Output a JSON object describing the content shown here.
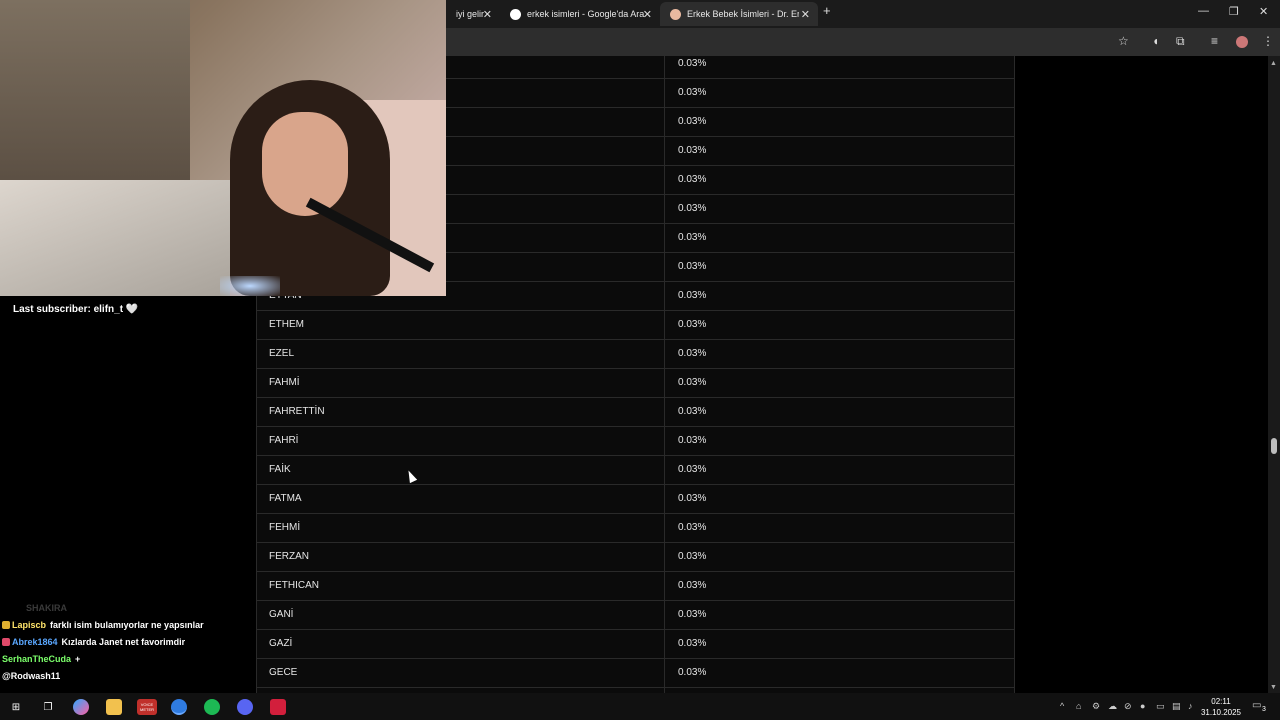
{
  "browser": {
    "tabs": [
      {
        "label": "iyi gelir",
        "active": false
      },
      {
        "label": "erkek isimleri - Google'da Ara",
        "active": false
      },
      {
        "label": "Erkek Bebek İsimleri - Dr. Ertuğ",
        "active": true
      }
    ],
    "new_tab": "+",
    "controls": {
      "minimize": "—",
      "restore": "❐",
      "close": "✕"
    }
  },
  "table": {
    "rows": [
      {
        "name": "",
        "percent": "0.03%"
      },
      {
        "name": "",
        "percent": "0.03%"
      },
      {
        "name": "",
        "percent": "0.03%"
      },
      {
        "name": "",
        "percent": "0.03%"
      },
      {
        "name": "",
        "percent": "0.03%"
      },
      {
        "name": "",
        "percent": "0.03%"
      },
      {
        "name": "",
        "percent": "0.03%"
      },
      {
        "name": "",
        "percent": "0.03%"
      },
      {
        "name": "EYTAN",
        "percent": "0.03%"
      },
      {
        "name": "ETHEM",
        "percent": "0.03%"
      },
      {
        "name": "EZEL",
        "percent": "0.03%"
      },
      {
        "name": "FAHMİ",
        "percent": "0.03%"
      },
      {
        "name": "FAHRETTİN",
        "percent": "0.03%"
      },
      {
        "name": "FAHRİ",
        "percent": "0.03%"
      },
      {
        "name": "FAİK",
        "percent": "0.03%"
      },
      {
        "name": "FATMA",
        "percent": "0.03%"
      },
      {
        "name": "FEHMİ",
        "percent": "0.03%"
      },
      {
        "name": "FERZAN",
        "percent": "0.03%"
      },
      {
        "name": "FETHICAN",
        "percent": "0.03%"
      },
      {
        "name": "GANİ",
        "percent": "0.03%"
      },
      {
        "name": "GAZİ",
        "percent": "0.03%"
      },
      {
        "name": "GECE",
        "percent": "0.03%"
      },
      {
        "name": "",
        "percent": ""
      }
    ]
  },
  "overlay": {
    "last_subscriber": "Last subscriber: elifn_t 🤍",
    "chat": [
      {
        "user": "SHAKIRA",
        "message": "",
        "user_color": "#3a3a3a"
      },
      {
        "user": "Lapiscb",
        "message": "farklı isim bulamıyorlar ne yapsınlar",
        "user_color": "#ffe56b"
      },
      {
        "user": "Abrek1864",
        "message": "Kızlarda Janet net favorimdir",
        "user_color": "#5aa7ff"
      },
      {
        "user": "SerhanTheCuda",
        "message": "+",
        "user_color": "#7cff6b"
      },
      {
        "user": "@Rodwash11",
        "message": "",
        "user_color": "#ffffff"
      }
    ]
  },
  "taskbar": {
    "clock_time": "02:11",
    "clock_date": "31.10.2025",
    "notification_count": "3",
    "vm_label": "VOICE METER"
  }
}
